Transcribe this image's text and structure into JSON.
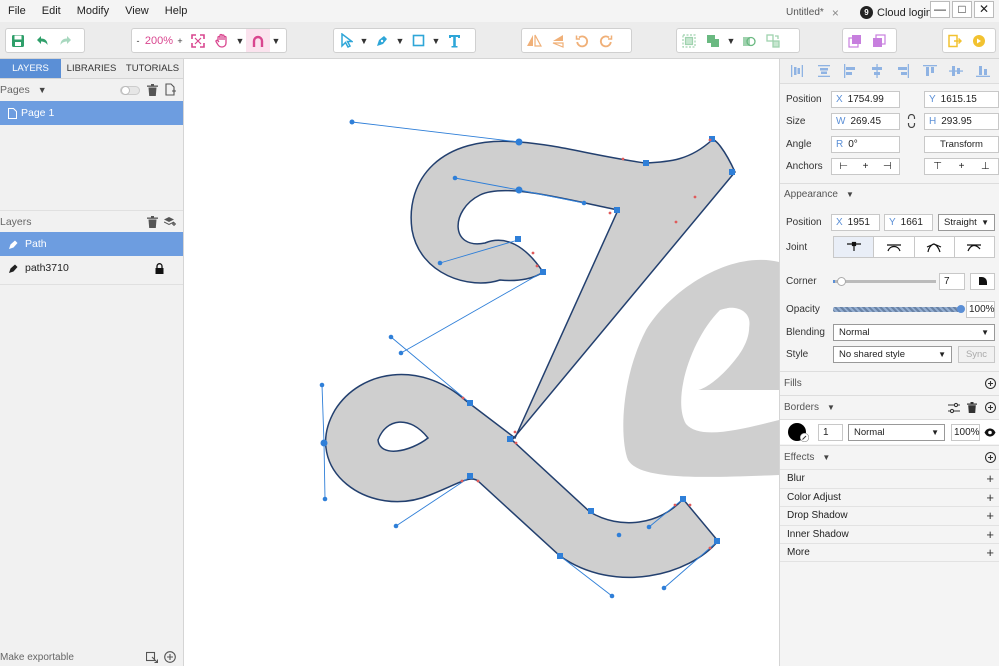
{
  "menubar": {
    "items": [
      "File",
      "Edit",
      "Modify",
      "View",
      "Help"
    ],
    "doc_tab": "Untitled*",
    "doc_close": "×",
    "cloud_login": "Cloud login",
    "cloud_badge": "9",
    "win_minimize": "—",
    "win_maximize": "□",
    "win_close": "✕"
  },
  "toolbar": {
    "zoom_minus": "-",
    "zoom_value": "200%",
    "zoom_plus": "+"
  },
  "left_panel": {
    "tabs": [
      "LAYERS",
      "LIBRARIES",
      "TUTORIALS"
    ],
    "pages_label": "Pages",
    "pages": [
      "Page 1"
    ],
    "layers_label": "Layers",
    "layers": [
      {
        "name": "Path",
        "selected": true
      },
      {
        "name": "path3710",
        "locked": true
      }
    ],
    "make_exportable": "Make exportable"
  },
  "inspector": {
    "position_label": "Position",
    "x_prefix": "X",
    "x": "1754.99",
    "y_prefix": "Y",
    "y": "1615.15",
    "size_label": "Size",
    "w_prefix": "W",
    "w": "269.45",
    "h_prefix": "H",
    "h": "293.95",
    "angle_label": "Angle",
    "r_prefix": "R",
    "angle": "0°",
    "transform_button": "Transform",
    "anchors_label": "Anchors",
    "appearance_label": "Appearance",
    "point_position_label": "Position",
    "px_prefix": "X",
    "px": "1951",
    "py_prefix": "Y",
    "py": "1661",
    "point_type": "Straight",
    "joint_label": "Joint",
    "corner_label": "Corner",
    "corner_value": "7",
    "corner_slider_fraction": 0.02,
    "opacity_label": "Opacity",
    "opacity_value": "100%",
    "opacity_fraction": 1.0,
    "blending_label": "Blending",
    "blending_value": "Normal",
    "style_label": "Style",
    "style_value": "No shared style",
    "sync_button": "Sync",
    "fills_label": "Fills",
    "borders_label": "Borders",
    "border_width": "1",
    "border_blend": "Normal",
    "border_opacity": "100%",
    "effects_label": "Effects",
    "effects": [
      "Blur",
      "Color Adjust",
      "Drop Shadow",
      "Inner Shadow",
      "More"
    ]
  },
  "colors": {
    "accent": "#5b8fd6",
    "selection_row": "#6d9de0",
    "shape_fill": "#cfcfcf",
    "path_stroke": "#23406f",
    "handle": "#2f7fd8",
    "zoom_pink": "#d9468f"
  }
}
